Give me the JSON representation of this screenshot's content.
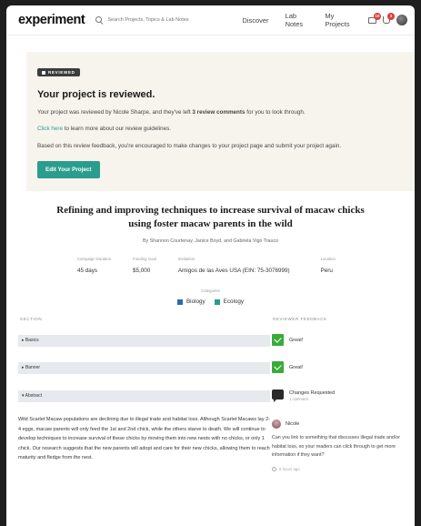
{
  "header": {
    "logo": "experiment",
    "search_placeholder": "Search Projects, Topics & Lab Notes",
    "nav": [
      "Discover",
      "Lab Notes",
      "My Projects"
    ],
    "badges": {
      "mail": "10",
      "notifications": "3"
    }
  },
  "review": {
    "tag": "REVIEWED",
    "title": "Your project is reviewed.",
    "line1_prefix": "Your project was reviewed by Nicole Sharpe, and they've left ",
    "line1_bold": "3 review comments",
    "line1_suffix": " for you to look through.",
    "link_text": "Click here",
    "link_suffix": " to learn more about our review guidelines.",
    "line3": "Based on this review feedback, you're encouraged to make changes to your project page and submit your project again.",
    "button": "Edit Your Project"
  },
  "project": {
    "title": "Refining and improving techniques to increase survival of macaw chicks using foster macaw parents in the wild",
    "authors": "By Shannon Courtenay, Janice Boyd, and Gabriela Vigo Trauco",
    "meta": [
      {
        "label": "Campaign Duration",
        "value": "45 days"
      },
      {
        "label": "Funding Goal",
        "value": "$5,000"
      },
      {
        "label": "Institution",
        "value": "Amigos de las Aves USA (EIN: 75-3076999)"
      },
      {
        "label": "Location",
        "value": "Peru"
      }
    ],
    "categories_label": "Categories",
    "categories": [
      {
        "name": "Biology",
        "color": "#2b6cb0"
      },
      {
        "name": "Ecology",
        "color": "#2a9d8f"
      }
    ]
  },
  "review_sections": {
    "section_label": "SECTION",
    "feedback_label": "REVIEWER FEEDBACK",
    "items": [
      {
        "name": "▸ Basics",
        "feedback": "Great!"
      },
      {
        "name": "▸ Banner",
        "feedback": "Great!"
      },
      {
        "name": "▾ Abstract",
        "feedback": "Changes Requested",
        "sub": "1 comment"
      }
    ],
    "abstract_text": "Wild Scarlet Macaw populations are declining due to illegal trade and habitat loss. Although Scarlet Macaws lay 2-4 eggs, macaw parents will only feed the 1st and 2nd chick, while the others starve to death. We will continue to develop techniques to increase survival of these chicks by moving them into new nests with no chicks, or only 1 chick. Our research suggests that the new parents will adopt and care for their new chicks, allowing them to reach maturity and fledge from the nest.",
    "comment": {
      "author": "Nicole",
      "text": "Can you link to something that discusses illegal trade and/or habitat loss, so your readers can click through to get more information if they want?",
      "time": "6 hours ago"
    }
  }
}
